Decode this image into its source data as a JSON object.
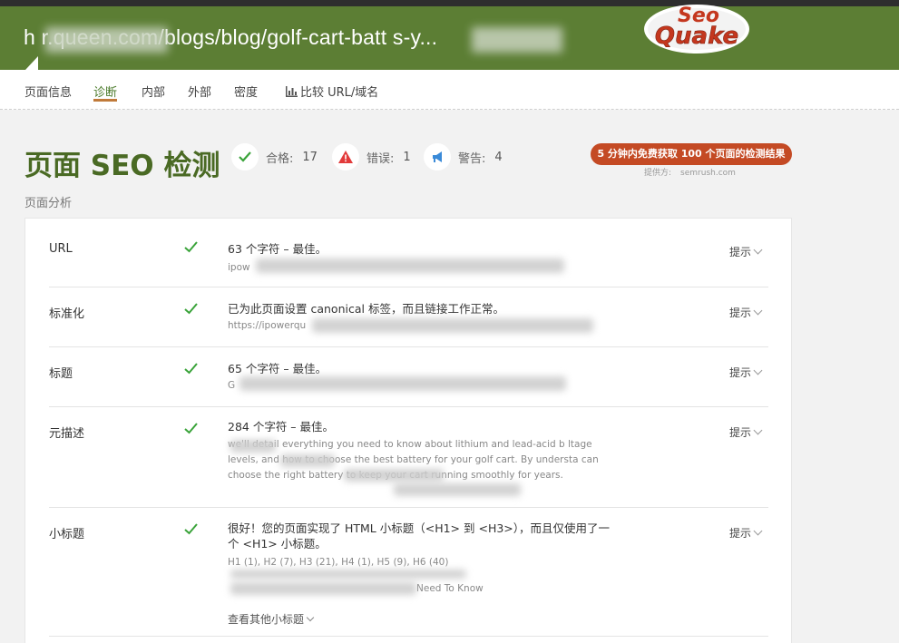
{
  "header": {
    "url": "h            r.queen.com/blogs/blog/golf-cart-batt     s-y...",
    "logo_top": "Seo",
    "logo_bottom": "Quake",
    "colors": {
      "bar": "#5c7e34",
      "accent": "#c44a24"
    }
  },
  "nav": {
    "items": [
      {
        "label": "页面信息"
      },
      {
        "label": "诊断"
      },
      {
        "label": "内部"
      },
      {
        "label": "外部"
      },
      {
        "label": "密度"
      },
      {
        "label": "比较 URL/域名"
      }
    ],
    "active_index": 1
  },
  "summary": {
    "title": "页面 SEO 检测",
    "pass": {
      "label": "合格:",
      "count": "17"
    },
    "error": {
      "label": "错误:",
      "count": "1"
    },
    "warning": {
      "label": "警告:",
      "count": "4"
    },
    "cta": "5 分钟内免费获取 100 个页面的检测结果",
    "provider_label": "提供方:",
    "provider": "semrush.com"
  },
  "section_label": "页面分析",
  "rows": [
    {
      "label": "URL",
      "text": "63 个字符 – 最佳。",
      "sub": "ipow"
    },
    {
      "label": "标准化",
      "text": "已为此页面设置 canonical 标签，而且链接工作正常。",
      "sub": "https://ipowerqu"
    },
    {
      "label": "标题",
      "text": "65 个字符 – 最佳。",
      "sub": "G"
    },
    {
      "label": "元描述",
      "text": "284 个字符 – 最佳。",
      "sub": "     we'll detail everything you need to know about lithium and lead-acid b              ltage levels, and how to choose the best battery for your golf cart. By understa                    can choose the right battery to keep your cart running smoothly for years."
    },
    {
      "label": "小标题",
      "text": "很好！您的页面实现了 HTML 小标题（<H1> 到 <H3>），而且仅使用了一个 <H1> 小标题。",
      "sub": "H1 (1), H2 (7), H3 (21), H4 (1), H5 (9), H6 (40)",
      "sub2": "Need To Know",
      "more": "查看其他小标题"
    }
  ],
  "hint_label": "提示"
}
